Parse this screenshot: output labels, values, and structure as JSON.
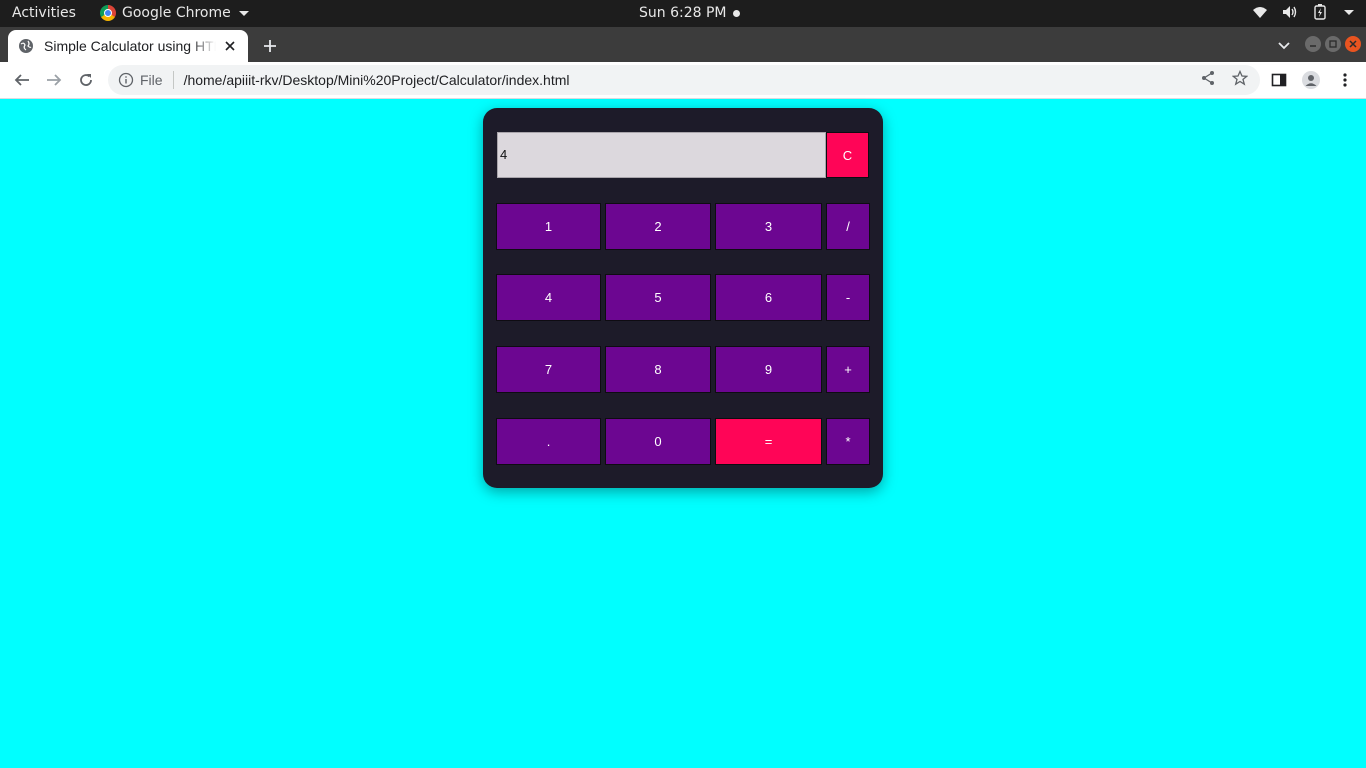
{
  "system": {
    "activities": "Activities",
    "app_name": "Google Chrome",
    "clock": "Sun  6:28 PM"
  },
  "browser": {
    "tab_title": "Simple Calculator using HTML",
    "url_scheme": "File",
    "url": "/home/apiiit-rkv/Desktop/Mini%20Project/Calculator/index.html"
  },
  "calculator": {
    "display_value": "4",
    "clear_label": "C",
    "rows": [
      [
        "1",
        "2",
        "3",
        "/"
      ],
      [
        "4",
        "5",
        "6",
        "-"
      ],
      [
        "7",
        "8",
        "9",
        "+"
      ],
      [
        ".",
        "0",
        "=",
        "*"
      ]
    ]
  },
  "colors": {
    "page_bg": "#00ffff",
    "calculator_bg": "#1d1b29",
    "button_purple": "#6c0691",
    "button_pink": "#ff0557",
    "display_bg": "#dcd8dd"
  }
}
